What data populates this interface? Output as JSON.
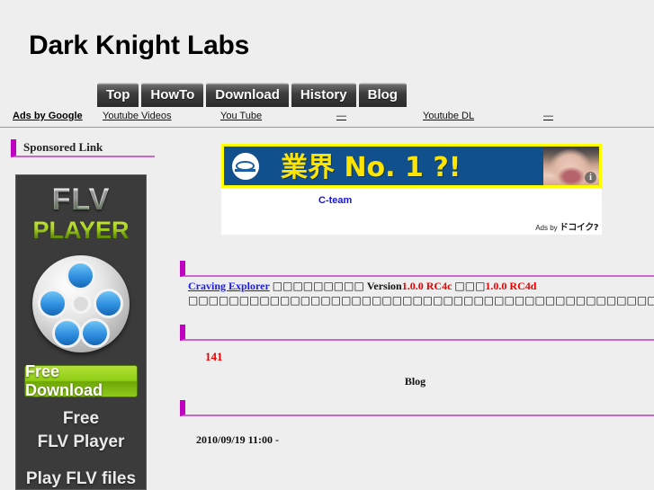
{
  "site": {
    "title": "Dark Knight Labs",
    "background": "#eeeeee",
    "accent": "#c000c0"
  },
  "nav": {
    "tabs": [
      {
        "label": "Top"
      },
      {
        "label": "HowTo"
      },
      {
        "label": "Download"
      },
      {
        "label": "History"
      },
      {
        "label": "Blog"
      }
    ]
  },
  "ads_bar": {
    "ads_by_google": "Ads by Google",
    "links": [
      {
        "label": "Youtube Videos"
      },
      {
        "label": "You Tube"
      },
      {
        "label": "—"
      },
      {
        "label": "Youtube DL"
      },
      {
        "label": "—"
      }
    ]
  },
  "sidebar": {
    "heading": "Sponsored Link",
    "flv_ad": {
      "title_line1": "FLV",
      "title_line2": "PLAYER",
      "button_label": "Free Download",
      "sub_line1": "Free",
      "sub_line2": "FLV Player",
      "sub_line3": "Play FLV files",
      "icon": "film-reel-icon",
      "bg_color": "#3b3b3b",
      "button_color": "#8fce14"
    }
  },
  "banner_ad": {
    "headline": "業界 No. 1 ?!",
    "bg_color": "#10508c",
    "border_color": "#ffff00",
    "text_color": "#ffe400",
    "info_badge": "i",
    "body_link": "C-team",
    "ads_by_prefix": "Ads by",
    "ads_by_brand": "ドコイク?"
  },
  "main": {
    "article": {
      "link_text": "Craving Explorer",
      "text_before_version": "□□□□□□□□□",
      "version_label": "Version",
      "version_old": "1.0.0 RC4c",
      "text_mid": "□□□",
      "version_new": "1.0.0 RC4d",
      "text_after": "□□□□□□□□□□□□□□□",
      "text_line2": "□□□□□□□□□□□□□□□□□□□□□□□□□□□□□□□□"
    },
    "count": "141",
    "blog_label": "Blog",
    "post_date": "2010/09/19 11:00 -"
  }
}
